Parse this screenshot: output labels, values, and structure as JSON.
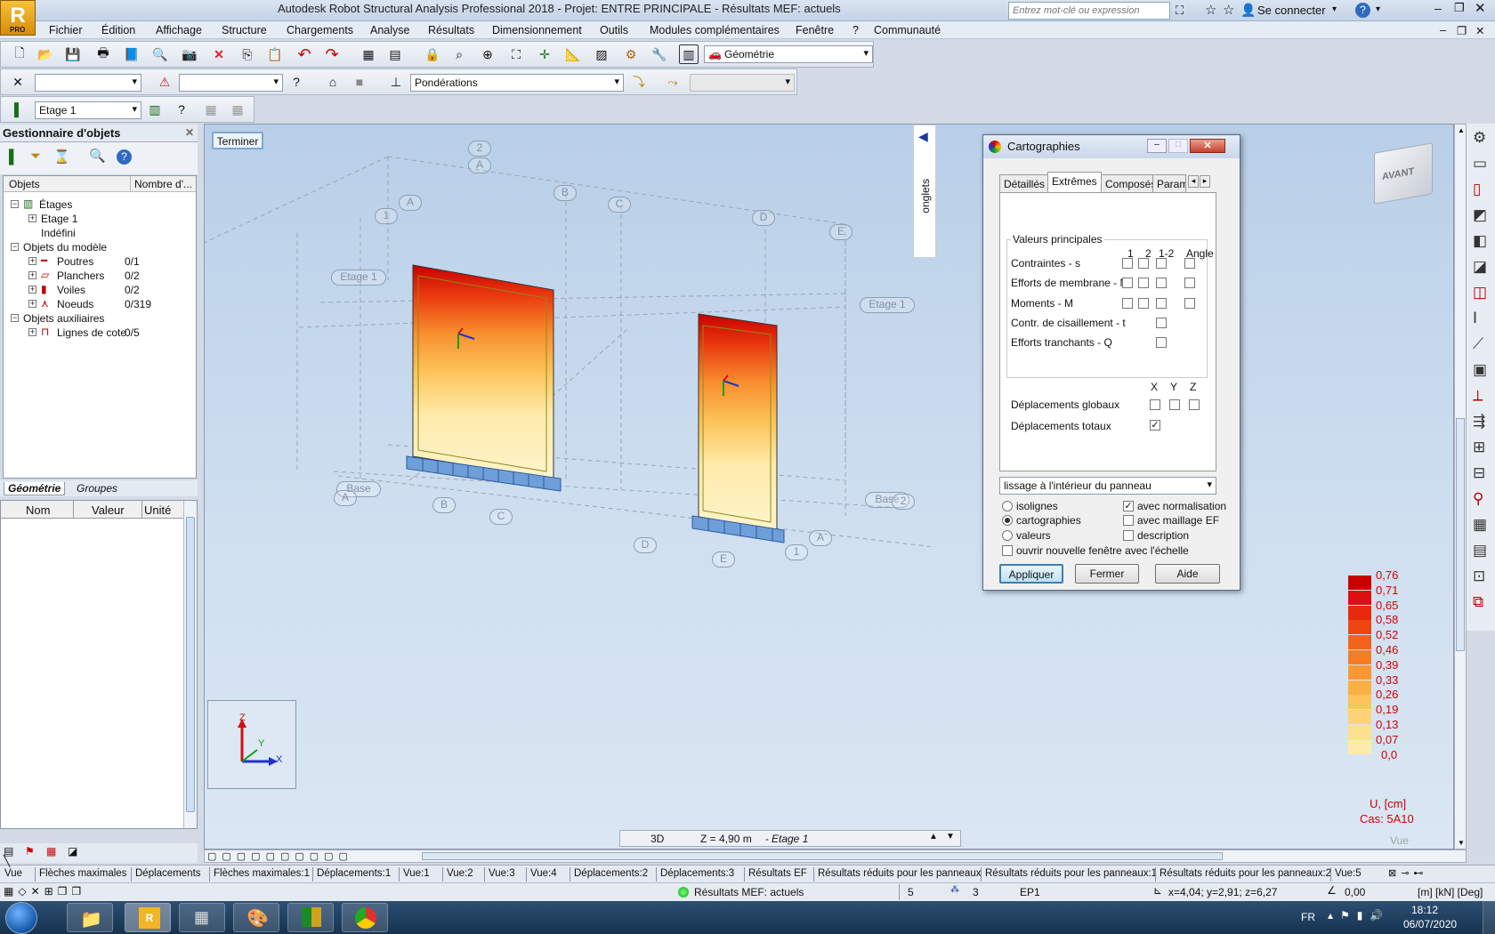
{
  "app": {
    "title": "Autodesk Robot Structural Analysis Professional 2018 - Projet: ENTRE PRINCIPALE - Résultats MEF: actuels",
    "logo_letter": "R",
    "logo_sub": "PRO",
    "search_placeholder": "Entrez mot-clé ou expression",
    "signin": "Se connecter"
  },
  "menu": [
    "Fichier",
    "Édition",
    "Affichage",
    "Structure",
    "Chargements",
    "Analyse",
    "Résultats",
    "Dimensionnement",
    "Outils",
    "Modules complémentaires",
    "Fenêtre",
    "?",
    "Communauté"
  ],
  "toolbar": {
    "layout_combo": "Géométrie",
    "load_combo": "Pondérations",
    "storey_combo": "Etage 1"
  },
  "object_manager": {
    "title": "Gestionnaire d'objets",
    "col_objects": "Objets",
    "col_count": "Nombre d'...",
    "tree": [
      {
        "label": "Étages",
        "count": "",
        "level": 0,
        "exp": "−",
        "icon": "storeys-icon"
      },
      {
        "label": "Etage 1",
        "count": "",
        "level": 1,
        "exp": "+",
        "icon": ""
      },
      {
        "label": "Indéfini",
        "count": "",
        "level": 1,
        "exp": "",
        "icon": ""
      },
      {
        "label": "Objets du modèle",
        "count": "",
        "level": 0,
        "exp": "−",
        "icon": ""
      },
      {
        "label": "Poutres",
        "count": "0/1",
        "level": 1,
        "exp": "+",
        "icon": "beam-icon"
      },
      {
        "label": "Planchers",
        "count": "0/2",
        "level": 1,
        "exp": "+",
        "icon": "slab-icon"
      },
      {
        "label": "Voiles",
        "count": "0/2",
        "level": 1,
        "exp": "+",
        "icon": "wall-icon"
      },
      {
        "label": "Noeuds",
        "count": "0/319",
        "level": 1,
        "exp": "+",
        "icon": "node-icon"
      },
      {
        "label": "Objets auxiliaires",
        "count": "",
        "level": 0,
        "exp": "−",
        "icon": ""
      },
      {
        "label": "Lignes de cote",
        "count": "0/5",
        "level": 1,
        "exp": "+",
        "icon": "dimension-icon"
      }
    ],
    "tabs": [
      "Géométrie",
      "Groupes"
    ],
    "prop_cols": [
      "Nom",
      "Valeur",
      "Unité"
    ]
  },
  "viewport": {
    "finish_button": "Terminer",
    "side_tab": "onglets",
    "viewcube": "AVANT",
    "grid_labels": {
      "top_2": "2",
      "top_A": "A",
      "A": "A",
      "one": "1",
      "B": "B",
      "C": "C",
      "D": "D",
      "E": "E",
      "etage_left": "Etage 1",
      "etage_right": "Etage 1",
      "base_left": "Base",
      "base_right": "Base",
      "bl_A": "A",
      "bl_B": "B",
      "bl_C": "C",
      "br_2": "2",
      "br_A": "A",
      "br_1": "1",
      "br_D": "D",
      "br_E": "E"
    },
    "axis": {
      "z": "Z",
      "y": "Y",
      "x": "X"
    },
    "bottom_view": "3D",
    "level_text": "Z = 4,90 m",
    "level_name": "Etage 1",
    "vue_label": "Vue"
  },
  "dialog": {
    "title": "Cartographies",
    "tabs": [
      "Détaillés",
      "Extrêmes",
      "Composés",
      "Paramè"
    ],
    "group_label": "Valeurs principales",
    "col_headers": [
      "1",
      "2",
      "1-2",
      "Angle"
    ],
    "rows": [
      {
        "label": "Contraintes - s"
      },
      {
        "label": "Efforts de membrane - N"
      },
      {
        "label": "Moments - M"
      },
      {
        "label": "Contr. de cisaillement - t"
      },
      {
        "label": "Efforts tranchants - Q"
      }
    ],
    "xyz_headers": [
      "X",
      "Y",
      "Z"
    ],
    "global_disp": "Déplacements globaux",
    "total_disp": "Déplacements totaux",
    "smoothing": "lissage à l'intérieur du panneau",
    "opt_isolines": "isolignes",
    "opt_maps": "cartographies",
    "opt_values": "valeurs",
    "opt_norm": "avec normalisation",
    "opt_mesh": "avec maillage EF",
    "opt_desc": "description",
    "opt_newwin": "ouvrir nouvelle fenêtre avec l'échelle",
    "btn_apply": "Appliquer",
    "btn_close": "Fermer",
    "btn_help": "Aide"
  },
  "legend": {
    "values": [
      "0,76",
      "0,71",
      "0,65",
      "0,58",
      "0,52",
      "0,46",
      "0,39",
      "0,33",
      "0,26",
      "0,19",
      "0,13",
      "0,07",
      "0,0"
    ],
    "colors": [
      "#c80000",
      "#dc1010",
      "#e82a0c",
      "#ef4611",
      "#f4621b",
      "#f77d25",
      "#f99832",
      "#fbb043",
      "#fcc45a",
      "#fdd473",
      "#fde18e",
      "#feebab",
      "#fff4cc"
    ],
    "unit": "U, [cm]",
    "case": "Cas: 5A10"
  },
  "view_tabs": [
    "Vue",
    "Flèches maximales",
    "Déplacements",
    "Flèches maximales:1",
    "Déplacements:1",
    "Vue:1",
    "Vue:2",
    "Vue:3",
    "Vue:4",
    "Déplacements:2",
    "Déplacements:3",
    "Résultats EF",
    "Résultats réduits pour les panneaux",
    "Résultats réduits pour les panneaux:1",
    "Résultats réduits pour les panneaux:2",
    "Vue:5"
  ],
  "status": {
    "results": "Résultats MEF: actuels",
    "num1": "5",
    "num2": "3",
    "code": "EP1",
    "coords": "x=4,04; y=2,91; z=6,27",
    "angle": "0,00",
    "units": "[m] [kN] [Deg]"
  },
  "taskbar": {
    "lang": "FR",
    "time": "18:12",
    "date": "06/07/2020"
  }
}
